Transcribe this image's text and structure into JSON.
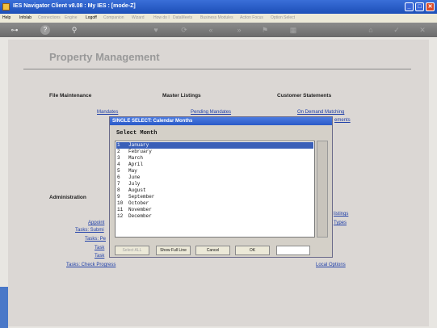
{
  "window": {
    "title": "IES Navigator Client v8.08 : My IES :      [mode-Z]",
    "min": "_",
    "max": "□",
    "close": "✕"
  },
  "menu": {
    "items": [
      {
        "label": "Help",
        "dim": false
      },
      {
        "label": "Infolab",
        "dim": false
      },
      {
        "label": "Connections",
        "dim": true
      },
      {
        "label": "Engine",
        "dim": true
      },
      {
        "label": "Logoff",
        "dim": false
      },
      {
        "label": "Companion",
        "dim": true
      },
      {
        "label": "Wizard",
        "dim": true
      },
      {
        "label": "How do I",
        "dim": true
      },
      {
        "label": "DataMeets",
        "dim": true
      },
      {
        "label": "Business Modules",
        "dim": true
      },
      {
        "label": "Action Focus",
        "dim": true
      },
      {
        "label": "Option Select",
        "dim": true
      }
    ]
  },
  "toolbar": {
    "icons": [
      "key-icon",
      "help-icon",
      "search-icon",
      "heart-icon",
      "refresh-icon",
      "back-icon",
      "forward-icon",
      "flag-icon",
      "save-icon",
      "home-icon",
      "check-icon",
      "close-icon"
    ],
    "glyphs": [
      "⊶",
      "?",
      "⚲",
      "♥",
      "⟳",
      "«",
      "»",
      "⚑",
      "▦",
      "⌂",
      "✓",
      "✕"
    ]
  },
  "content": {
    "title": "Property Management",
    "col_file": "File Maintenance",
    "col_master": "Master Listings",
    "col_customer": "Customer Statements",
    "admin": "Administration",
    "links": {
      "mandates": "Mandates",
      "pending_mandates": "Pending Mandates",
      "on_demand": "On Demand Matching",
      "statements": "ements",
      "listings": "listings",
      "types": "Types",
      "appoint": "Appoint",
      "tasks_submit": "Tasks: Submi",
      "tasks_pe": "Tasks: Pe",
      "tasks": "Task",
      "tasks2": "Task",
      "tasks_check": "Tasks: Check Progress",
      "local_options": "Local Options"
    }
  },
  "dialog": {
    "title": "SINGLE SELECT: Calendar Months",
    "header": "Select Month",
    "months": [
      {
        "num": "1",
        "name": "January",
        "selected": true
      },
      {
        "num": "2",
        "name": "February",
        "selected": false
      },
      {
        "num": "3",
        "name": "March",
        "selected": false
      },
      {
        "num": "4",
        "name": "April",
        "selected": false
      },
      {
        "num": "5",
        "name": "May",
        "selected": false
      },
      {
        "num": "6",
        "name": "June",
        "selected": false
      },
      {
        "num": "7",
        "name": "July",
        "selected": false
      },
      {
        "num": "8",
        "name": "August",
        "selected": false
      },
      {
        "num": "9",
        "name": "September",
        "selected": false
      },
      {
        "num": "10",
        "name": "October",
        "selected": false
      },
      {
        "num": "11",
        "name": "November",
        "selected": false
      },
      {
        "num": "12",
        "name": "December",
        "selected": false
      }
    ],
    "buttons": {
      "select_all": "Select ALL",
      "show_full": "Show Full Line",
      "cancel": "Cancel",
      "ok": "OK"
    },
    "entry_value": ""
  },
  "colors": {
    "accent": "#2a5ac8",
    "selection": "#3a5fb8",
    "link": "#1f3fa8"
  }
}
